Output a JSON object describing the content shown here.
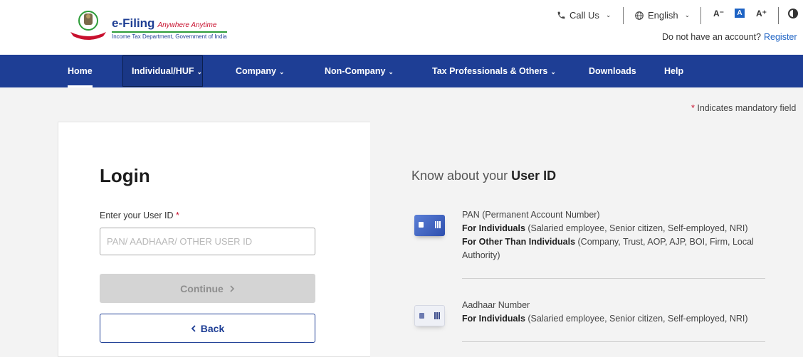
{
  "header": {
    "logo_brand": "e-Filing",
    "logo_tagline": "Anywhere Anytime",
    "logo_subtitle": "Income Tax Department, Government of India",
    "call_us": "Call Us",
    "language": "English",
    "font_decrease": "A⁻",
    "font_normal": "A",
    "font_increase": "A⁺",
    "no_account": "Do not have an account?",
    "register": "Register"
  },
  "nav": {
    "items": [
      {
        "label": "Home"
      },
      {
        "label": "Individual/HUF"
      },
      {
        "label": "Company"
      },
      {
        "label": "Non-Company"
      },
      {
        "label": "Tax Professionals & Others"
      },
      {
        "label": "Downloads"
      },
      {
        "label": "Help"
      }
    ]
  },
  "mandatory_note": "Indicates mandatory field",
  "login": {
    "title": "Login",
    "userid_label": "Enter your User ID",
    "userid_placeholder": "PAN/ AADHAAR/ OTHER USER ID",
    "userid_value": "",
    "continue_label": "Continue",
    "back_label": "Back"
  },
  "know": {
    "heading": "Know about your",
    "heading_strong": "User ID",
    "items": [
      {
        "title": "PAN (Permanent Account Number)",
        "line1_bold": "For Individuals",
        "line1": " (Salaried employee, Senior citizen, Self-employed, NRI)",
        "line2_bold": "For Other Than Individuals",
        "line2": " (Company, Trust, AOP, AJP, BOI, Firm, Local Authority)"
      },
      {
        "title": "Aadhaar Number",
        "line1_bold": "For Individuals",
        "line1": " (Salaried employee, Senior citizen, Self-employed, NRI)"
      }
    ]
  },
  "colors": {
    "nav_bg": "#1e3e95",
    "accent_blue": "#1e63c4",
    "mandatory_red": "#c8102e"
  },
  "icons": [
    "emblem-logo-icon",
    "phone-icon",
    "globe-icon",
    "chevron-down-icon",
    "contrast-icon",
    "chevron-right-icon",
    "chevron-left-icon",
    "pan-card-icon",
    "aadhaar-card-icon"
  ]
}
